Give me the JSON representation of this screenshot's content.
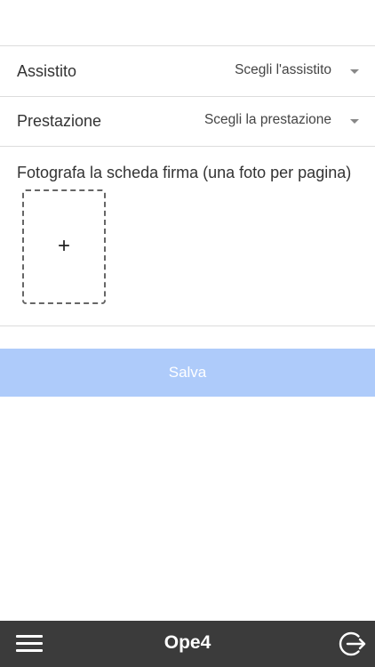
{
  "form": {
    "assistito": {
      "label": "Assistito",
      "placeholder": "Scegli l'assistito"
    },
    "prestazione": {
      "label": "Prestazione",
      "placeholder": "Scegli la prestazione"
    },
    "photo": {
      "label": "Fotografa la scheda firma (una foto per pagina)",
      "add_symbol": "+"
    },
    "save_label": "Salva",
    "save_color": "#aecbfa"
  },
  "bottom_bar": {
    "title": "Ope4",
    "background": "#3b3b3b",
    "left_icon": "menu-icon",
    "right_icon": "logout-icon"
  }
}
